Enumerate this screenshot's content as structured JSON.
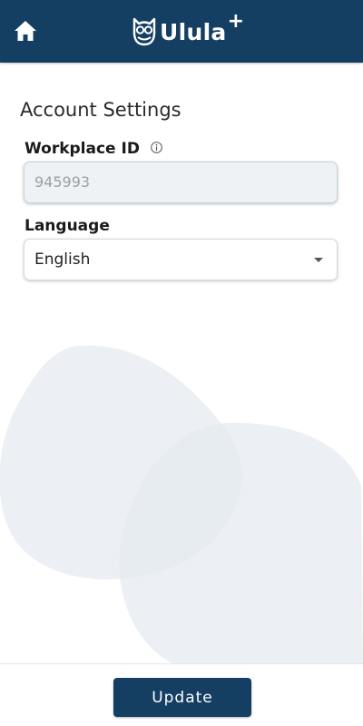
{
  "header": {
    "home_icon": "home-icon",
    "logo_icon": "owl-icon",
    "app_name": "Ulula",
    "app_name_suffix": "+",
    "brand_color": "#143f63"
  },
  "main": {
    "title": "Account Settings",
    "workplace": {
      "label": "Workplace ID",
      "info_icon": "info-icon",
      "value": "945993"
    },
    "language": {
      "label": "Language",
      "selected": "English",
      "caret_icon": "caret-down-icon"
    }
  },
  "footer": {
    "update_label": "Update"
  }
}
